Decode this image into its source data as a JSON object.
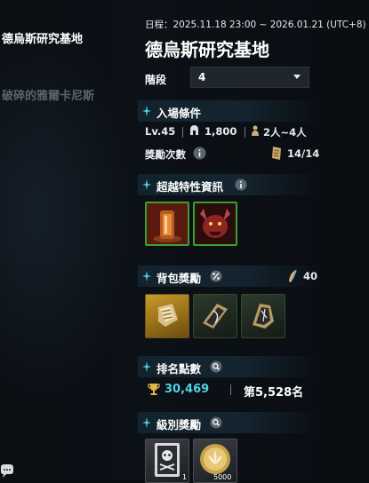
{
  "sidebar": {
    "items": [
      {
        "label": "德烏斯研究基地"
      },
      {
        "label": "破碎的雅爾卡尼斯"
      }
    ]
  },
  "header": {
    "schedule": "日程：2025.11.18 23:00 ~ 2026.01.21 (UTC+8)",
    "title": "德烏斯研究基地"
  },
  "stage": {
    "label": "階段",
    "value": "4"
  },
  "entry": {
    "title": "入場條件",
    "level": "Lv.45",
    "power": "1,800",
    "party": "2人~4人",
    "reward_count_label": "獎勵次數",
    "reward_count": "14/14"
  },
  "transcend": {
    "title": "超越特性資訊"
  },
  "bag_rewards": {
    "title": "背包獎勵",
    "bonus": "40"
  },
  "ranking": {
    "title": "排名點數",
    "points": "30,469",
    "rank": "第5,528名"
  },
  "tier_rewards": {
    "title": "級別獎勵",
    "items": [
      {
        "icon": "skull-card-icon",
        "qty": "1"
      },
      {
        "icon": "lotus-coin-icon",
        "qty": "5000"
      }
    ]
  },
  "colors": {
    "accent_cyan": "#4fd3e0",
    "tile_green_border": "#3aa033",
    "section_header_bg": "#13232d"
  }
}
